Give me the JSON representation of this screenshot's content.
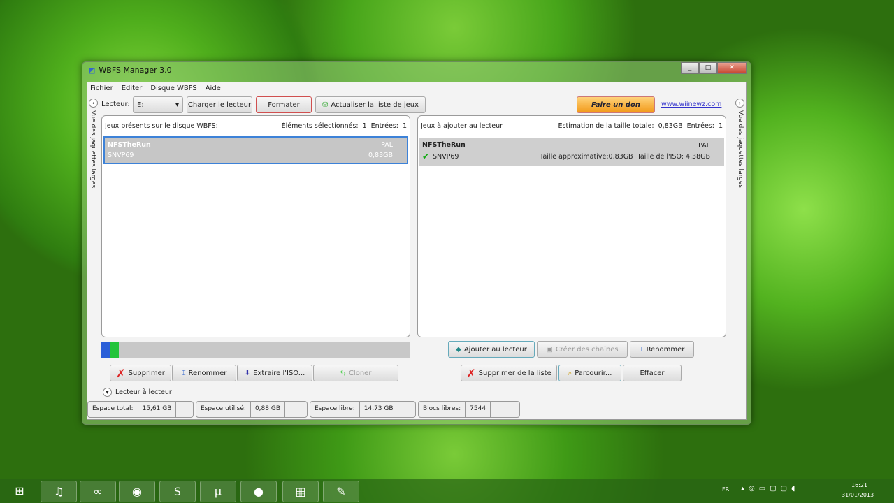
{
  "window": {
    "title": "WBFS Manager 3.0",
    "minimize": "_",
    "maximize": "□",
    "close": "✕"
  },
  "menu": [
    "Fichier",
    "Editer",
    "Disque WBFS",
    "Aide"
  ],
  "toolbar": {
    "drive_label": "Lecteur:",
    "drive_value": "E:",
    "load": "Charger le lecteur",
    "format": "Formater",
    "refresh": "Actualiser la liste de jeux",
    "donate": "Faire un don",
    "link": "www.wiinewz.com"
  },
  "side_label": "Vue des jaquettes larges",
  "left_panel": {
    "title": "Jeux présents sur le disque WBFS:",
    "selected_label": "Éléments sélectionnés:",
    "selected": "1",
    "entries_label": "Entrées:",
    "entries": "1",
    "game": {
      "name": "NFSTheRun",
      "id": "SNVP69",
      "region": "PAL",
      "size": "0,83GB"
    }
  },
  "right_panel": {
    "title": "Jeux à ajouter au lecteur",
    "estimate_label": "Estimation de la taille totale:",
    "estimate": "0,83GB",
    "entries_label": "Entrées:",
    "entries": "1",
    "game": {
      "name": "NFSTheRun",
      "id": "SNVP69",
      "region": "PAL",
      "approx": "Taille approximative:0,83GB",
      "iso": "Taille de l'ISO: 4,38GB"
    }
  },
  "usage": {
    "used_fraction": 0.056,
    "colors": {
      "used": "#2a5fd8",
      "free_seg": "#22c43a"
    }
  },
  "left_buttons": [
    "Supprimer",
    "Renommer",
    "Extraire l'ISO...",
    "Cloner"
  ],
  "right_buttons": [
    "Ajouter au lecteur",
    "Créer des chaînes",
    "Renommer",
    "Supprimer de la liste",
    "Parcourir...",
    "Effacer"
  ],
  "drive_to_drive": "Lecteur à lecteur",
  "status": [
    {
      "label": "Espace total:",
      "value": "15,61 GB"
    },
    {
      "label": "Espace utilisé:",
      "value": "0,88 GB"
    },
    {
      "label": "Espace libre:",
      "value": "14,73 GB"
    },
    {
      "label": "Blocs libres:",
      "value": "7544"
    }
  ],
  "taskbar": {
    "lang": "FR",
    "time": "16:21",
    "date": "31/01/2013"
  }
}
